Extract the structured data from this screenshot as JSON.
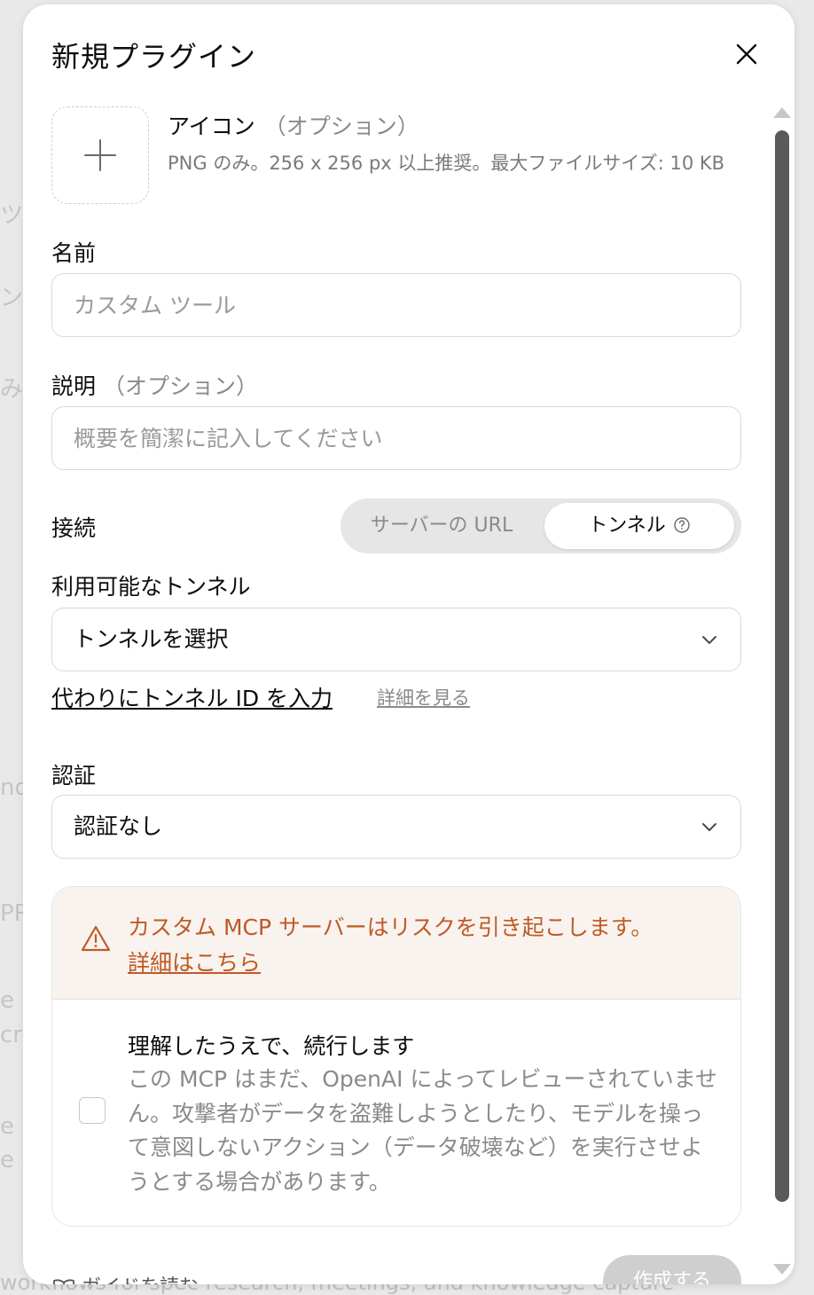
{
  "background": {
    "fragments": [
      "ツ",
      "ンを",
      "み",
      "nd",
      "PRs",
      "e D",
      "cro",
      "e C",
      "e G"
    ],
    "bottom_text": "workflows for spec research, meetings, and knowledge capture"
  },
  "modal": {
    "title": "新規プラグイン",
    "icon_section": {
      "title": "アイコン",
      "optional": "（オプション）",
      "hint": "PNG のみ。256 x 256 px 以上推奨。最大ファイルサイズ: 10 KB"
    },
    "name": {
      "label": "名前",
      "placeholder": "カスタム ツール"
    },
    "description": {
      "label": "説明",
      "optional": "（オプション）",
      "placeholder": "概要を簡潔に記入してください"
    },
    "connection": {
      "label": "接続",
      "options": [
        "サーバーの URL",
        "トンネル"
      ],
      "selected": "トンネル"
    },
    "tunnels": {
      "label": "利用可能なトンネル",
      "selected": "トンネルを選択",
      "enter_id_link": "代わりにトンネル ID を入力",
      "learn_more": "詳細を見る"
    },
    "auth": {
      "label": "認証",
      "selected": "認証なし"
    },
    "warning": {
      "text": "カスタム MCP サーバーはリスクを引き起こします。",
      "link": "詳細はこちら",
      "ack_title": "理解したうえで、続行します",
      "ack_description": "この MCP はまだ、OpenAI によってレビューされていません。攻撃者がデータを盗難しようとしたり、モデルを操って意図しないアクション（データ破壊など）を実行させようとする場合があります。",
      "ack_checked": false
    },
    "footer": {
      "guide": "ガイドを読む",
      "create": "作成する"
    }
  },
  "colors": {
    "warning": "#bf5a25",
    "accent_disabled": "#cfcfcf"
  }
}
